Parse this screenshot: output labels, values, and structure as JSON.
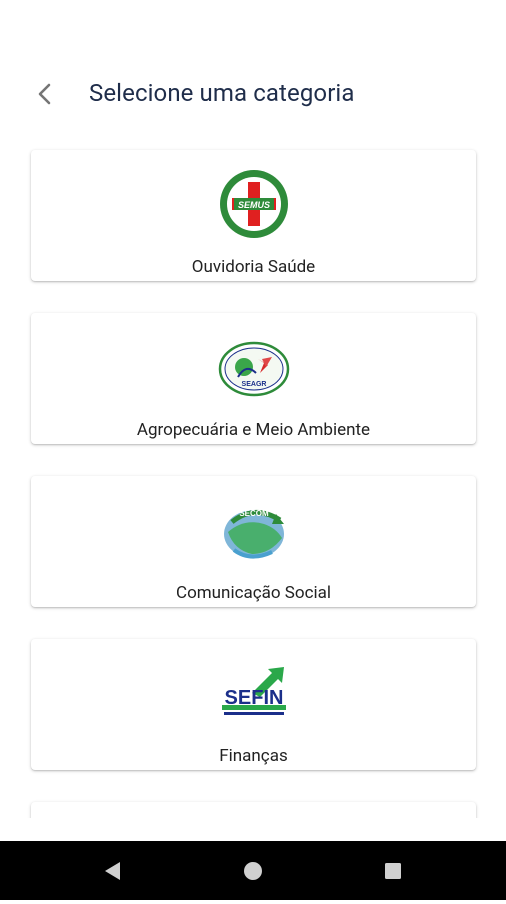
{
  "header": {
    "title": "Selecione uma categoria",
    "back_icon": "chevron-left-icon"
  },
  "categories": [
    {
      "label": "Ouvidoria Saúde",
      "logo_text": "SEMUS"
    },
    {
      "label": "Agropecuária e Meio Ambiente",
      "logo_text": "SEAGR"
    },
    {
      "label": "Comunicação Social",
      "logo_text": "SECOM"
    },
    {
      "label": "Finanças",
      "logo_text": "SEFIN"
    }
  ],
  "navbar": {
    "back_icon": "triangle-back-icon",
    "home_icon": "circle-home-icon",
    "recents_icon": "square-recents-icon"
  },
  "colors": {
    "title": "#1f2d4a",
    "navbar": "#000000",
    "semus_green": "#2e8b3a",
    "semus_red": "#e02020",
    "sefin_blue": "#1b2f8a",
    "sefin_green": "#2aa84a"
  }
}
